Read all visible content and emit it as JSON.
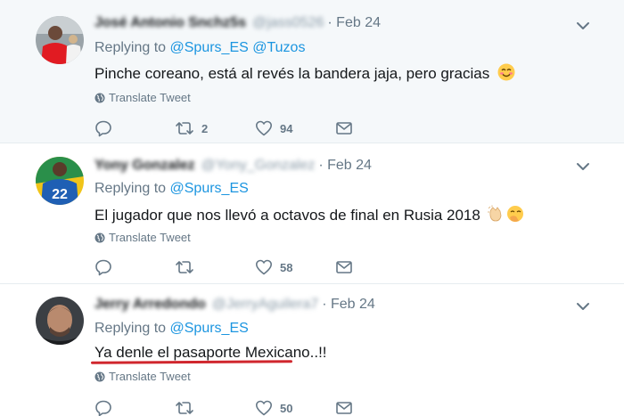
{
  "tweets": [
    {
      "name": "José Antonio Snchz5s",
      "handle": "@jass0526",
      "time": "· Feb 24",
      "reply_prefix": "Replying to",
      "reply_to": [
        "@Spurs_ES",
        "@Tuzos"
      ],
      "text": "Pinche coreano, está al revés la bandera jaja, pero gracias",
      "emoji": "smiling-face-emoji",
      "translate": "Translate Tweet",
      "retweets": "2",
      "likes": "94"
    },
    {
      "name": "Yony Gonzalez",
      "handle": "@Yony_Gonzalez",
      "time": "· Feb 24",
      "reply_prefix": "Replying to",
      "reply_to": [
        "@Spurs_ES"
      ],
      "text": "El jugador que nos llevó a octavos de final en Rusia 2018",
      "emoji": "clapping-hands-and-hand-over-mouth-emoji",
      "translate": "Translate Tweet",
      "retweets": "",
      "likes": "58"
    },
    {
      "name": "Jerry Arredondo",
      "handle": "@JerryAguilera7",
      "time": "· Feb 24",
      "reply_prefix": "Replying to",
      "reply_to": [
        "@Spurs_ES"
      ],
      "text": "Ya denle el pasaporte Mexicano..!!",
      "translate": "Translate Tweet",
      "retweets": "",
      "likes": "50"
    }
  ],
  "jersey_number": "22",
  "colors": {
    "link": "#1b95e0",
    "muted": "#657786",
    "highlight_bg": "#f5f8fa",
    "underline": "#d0262d"
  }
}
